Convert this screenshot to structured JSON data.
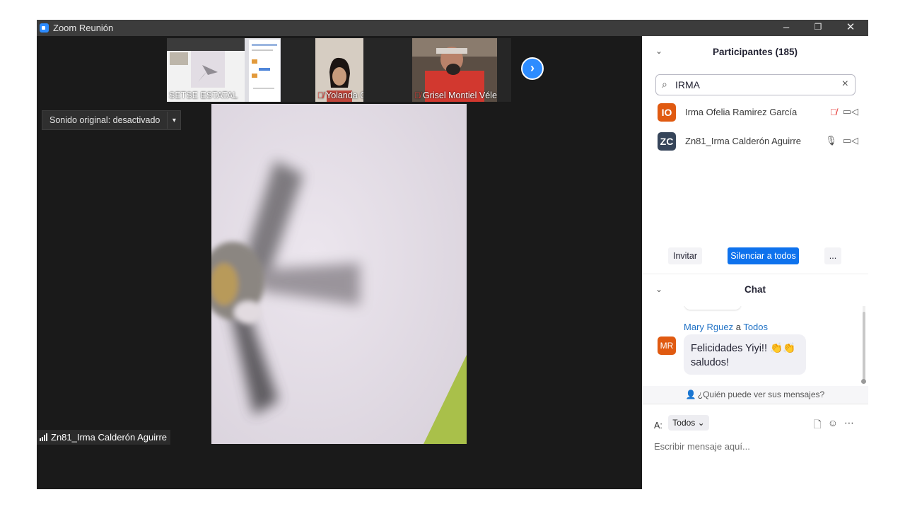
{
  "window": {
    "title": "Zoom Reunión",
    "controls": {
      "minimize": "–",
      "restore": "❐",
      "close": "✕"
    }
  },
  "thumbnails": [
    {
      "name": "SETSE ESTATAL",
      "muted": false
    },
    {
      "name": "Yolanda Gonzalez R",
      "muted": true
    },
    {
      "name": "Grisel Montiel Vélez",
      "muted": true
    }
  ],
  "next_button": "›",
  "original_sound": {
    "label": "Sonido original: desactivado",
    "arrow": "▾"
  },
  "active_speaker": "Zn81_Irma Calderón Aguirre",
  "participants": {
    "title": "Participantes (185)",
    "search_value": "IRMA",
    "list": [
      {
        "initials": "IO",
        "name": "Irma Ofelia Ramirez García",
        "avatar_color": "#e05a11",
        "mic_muted": true
      },
      {
        "initials": "ZC",
        "name": "Zn81_Irma Calderón Aguirre",
        "avatar_color": "#36455a",
        "mic_muted": false
      }
    ],
    "buttons": {
      "invite": "Invitar",
      "mute_all": "Silenciar a todos",
      "more": "..."
    }
  },
  "chat": {
    "title": "Chat",
    "message": {
      "sender": "Mary Rguez",
      "to_word": "a",
      "recipient": "Todos",
      "initials": "MR",
      "text_line1": "Felicidades Yiyi!!",
      "emoji": "👏👏",
      "text_line2": "saludos!"
    },
    "visibility": "¿Quién puede ver sus mensajes?",
    "to_label": "A:",
    "to_value": "Todos",
    "placeholder": "Escribir mensaje aquí..."
  },
  "colors": {
    "accent": "#2d8cff",
    "muted_red": "#e53935",
    "titlebar": "#3c3c3c",
    "stage": "#1a1a1a"
  }
}
